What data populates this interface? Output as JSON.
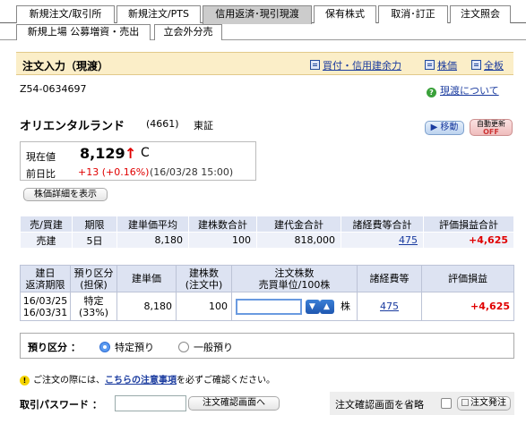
{
  "tabs": [
    "新規注文/取引所",
    "新規注文/PTS",
    "信用返済･現引現渡",
    "保有株式",
    "取消･訂正",
    "注文照会"
  ],
  "subtabs": [
    "新規上場 公募増資・売出",
    "立会外分売"
  ],
  "title": "注文入力（現渡）",
  "links": {
    "buy_margin": "買付・信用建余力",
    "stock_price": "株価",
    "full_board": "全板",
    "about": "現渡について"
  },
  "order_id": "Z54-0634697",
  "stock": {
    "name": "オリエンタルランド",
    "code": "(4661)",
    "market": "東証"
  },
  "buttons": {
    "move": "▶ 移動",
    "auto_update_top": "自動更新",
    "auto_update_off": "OFF",
    "detail": "株価詳細を表示",
    "confirm": "注文確認画面へ",
    "place": "注文発注"
  },
  "price": {
    "label_current": "現在値",
    "value": "8,129",
    "arrow": "↑",
    "flag": "C",
    "label_change": "前日比",
    "change": "+13 (+0.16%)",
    "time": "(16/03/28 15:00)"
  },
  "summary": {
    "headers": [
      "売/買建",
      "期限",
      "建単価平均",
      "建株数合計",
      "建代金合計",
      "諸経費等合計",
      "評価損益合計"
    ],
    "row": {
      "side": "売建",
      "period": "5日",
      "avg": "8,180",
      "qty": "100",
      "amount": "818,000",
      "fees": "475",
      "pl": "+4,625"
    }
  },
  "detail": {
    "headers": {
      "date1": "建日",
      "date2": "返済期限",
      "cat1": "預り区分",
      "cat2": "(担保)",
      "unit_price": "建単価",
      "qty1": "建株数",
      "qty2": "(注文中)",
      "ord1": "注文株数",
      "ord2": "売買単位/100株",
      "fees": "諸経費等",
      "pl": "評価損益"
    },
    "row": {
      "date1": "16/03/25",
      "date2": "16/03/31",
      "cat1": "特定",
      "cat2": "(33%)",
      "unit_price": "8,180",
      "qty": "100",
      "input": "",
      "unit": "株",
      "fees": "475",
      "pl": "+4,625"
    }
  },
  "deposit": {
    "label": "預り区分 ：",
    "opt1": "特定預り",
    "opt2": "一般預り"
  },
  "notice": {
    "pre": "ご注文の際には、",
    "link": "こちらの注意事項",
    "post": "を必ずご確認ください。"
  },
  "password": {
    "label": "取引パスワード ：",
    "value": ""
  },
  "skip_label": "注文確認画面を省略"
}
